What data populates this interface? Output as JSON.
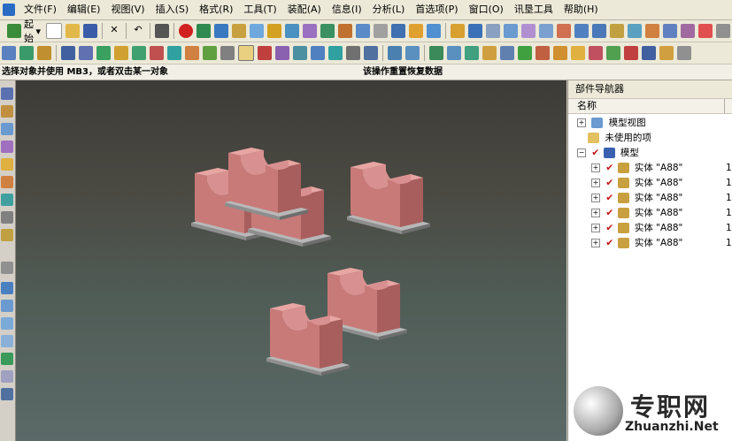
{
  "menu": [
    "文件(F)",
    "编辑(E)",
    "视图(V)",
    "插入(S)",
    "格式(R)",
    "工具(T)",
    "装配(A)",
    "信息(I)",
    "分析(L)",
    "首选项(P)",
    "窗口(O)",
    "讯垦工具",
    "帮助(H)"
  ],
  "toolbar": {
    "start_label": "起始"
  },
  "status": {
    "left": "选择对象并使用 MB3，或者双击某一对象",
    "right": "该操作重置恢复数据"
  },
  "navigator": {
    "title": "部件导航器",
    "column_name": "名称",
    "nodes": {
      "model_views": "模型视图",
      "unused_items": "未使用的项",
      "model": "模型"
    },
    "bodies": [
      {
        "label": "实体 \"A88\"",
        "value": "1"
      },
      {
        "label": "实体 \"A88\"",
        "value": "1"
      },
      {
        "label": "实体 \"A88\"",
        "value": "1"
      },
      {
        "label": "实体 \"A88\"",
        "value": "1"
      },
      {
        "label": "实体 \"A88\"",
        "value": "1"
      },
      {
        "label": "实体 \"A88\"",
        "value": "1"
      }
    ]
  },
  "watermark": {
    "cn": "专职网",
    "en": "Zhuanzhi.Net"
  },
  "colors": {
    "part_face_front": "#c87a78",
    "part_face_top": "#e8a6a3",
    "part_face_side": "#a85e5d",
    "base_plate": "#9a9a9a"
  }
}
